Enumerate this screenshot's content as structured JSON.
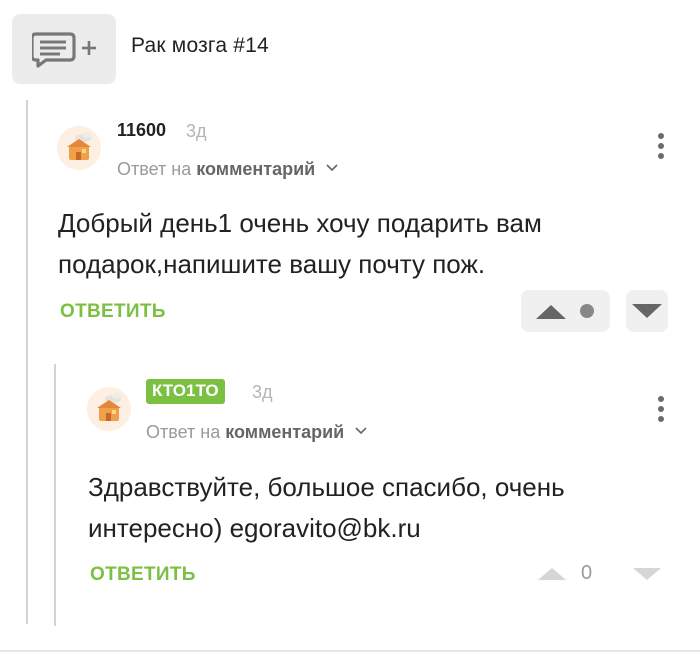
{
  "post": {
    "title": "Рак мозга #14",
    "icon": "comment-add-icon"
  },
  "comments": [
    {
      "author": "11600",
      "age": "3д",
      "reply_to_prefix": "Ответ на",
      "reply_to_target": "комментарий",
      "text_line1": "Добрый день1 очень  хочу подарить вам",
      "text_line2": "подарок,напишите вашу почту пож.",
      "reply_label": "ОТВЕТИТЬ",
      "score": "",
      "avatar_icon": "avatar-icon"
    },
    {
      "author": "КТО1ТО",
      "age": "3д",
      "reply_to_prefix": "Ответ на",
      "reply_to_target": "комментарий",
      "text_line1": "Здравствуйте, большое спасибо, очень",
      "text_line2": "интересно) egoravito@bk.ru",
      "reply_label": "ОТВЕТИТЬ",
      "score": "0",
      "avatar_icon": "avatar-icon"
    }
  ],
  "colors": {
    "accent_green": "#7bbf43",
    "muted_text": "#9a9a9a",
    "thread_line": "#d4d4d4"
  }
}
